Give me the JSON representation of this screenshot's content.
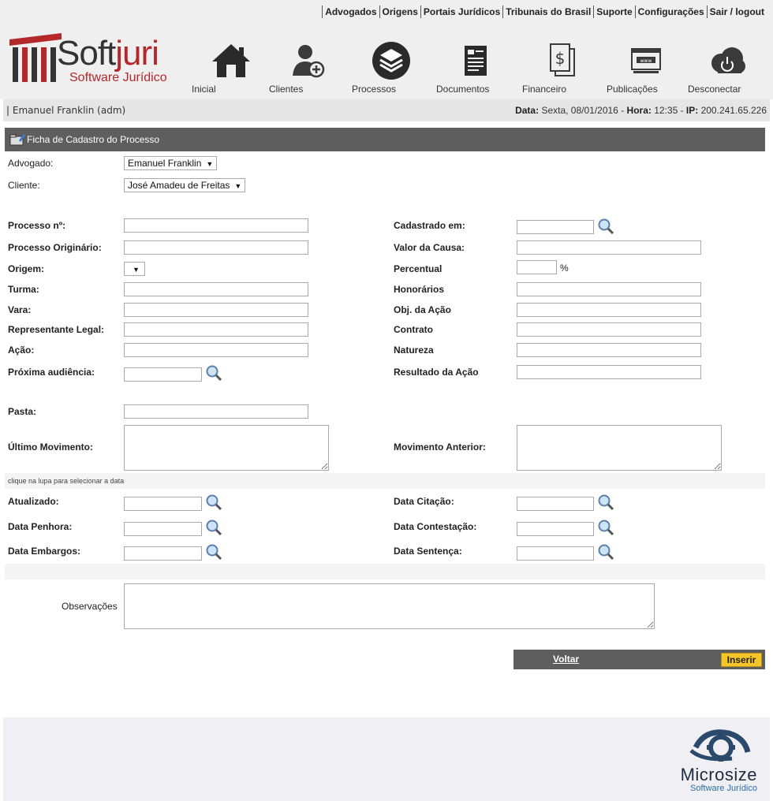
{
  "toplinks": [
    "Advogados",
    "Origens",
    "Portais Jurídicos",
    "Tribunais do Brasil",
    "Suporte",
    "Configurações",
    "Sair / logout"
  ],
  "brand": {
    "name_part1": "Soft",
    "name_part2": "juri",
    "sub": "Software Jurídico"
  },
  "nav": [
    {
      "label": "Inicial",
      "icon": "home-icon"
    },
    {
      "label": "Clientes",
      "icon": "add-client-icon"
    },
    {
      "label": "Processos",
      "icon": "layers-icon"
    },
    {
      "label": "Documentos",
      "icon": "document-icon"
    },
    {
      "label": "Financeiro",
      "icon": "dollar-document-icon"
    },
    {
      "label": "Publicações",
      "icon": "www-publication-icon"
    },
    {
      "label": "Desconectar",
      "icon": "power-cloud-icon"
    }
  ],
  "userbar": {
    "user": "| Emanuel Franklin (adm)",
    "data_label": "Data:",
    "data_value": " Sexta, 08/01/2016 - ",
    "hora_label": "Hora:",
    "hora_value": " 12:35 - ",
    "ip_label": "IP:",
    "ip_value": " 200.241.65.226"
  },
  "panel": {
    "title": "Ficha de Cadastro do Processo"
  },
  "form": {
    "advogado_label": "Advogado:",
    "advogado_value": "Emanuel Franklin",
    "cliente_label": "Cliente:",
    "cliente_value": "José Amadeu de Freitas",
    "processo_label": "Processo nº:",
    "processo_orig_label": "Processo Originário:",
    "origem_label": "Origem:",
    "turma_label": "Turma:",
    "vara_label": "Vara:",
    "representante_label": "Representante Legal:",
    "acao_label": "Ação:",
    "proxima_label": "Próxima audiência:",
    "cadastrado_label": "Cadastrado em:",
    "valor_label": "Valor da Causa:",
    "percentual_label": "Percentual",
    "percent_sign": "%",
    "honorarios_label": "Honorários",
    "obj_label": "Obj. da Ação",
    "contrato_label": "Contrato",
    "natureza_label": "Natureza",
    "resultado_label": "Resultado da Ação",
    "pasta_label": "Pasta:",
    "ultimo_label": "Último Movimento:",
    "anterior_label": "Movimento Anterior:",
    "hint": "clique na lupa para selecionar a data",
    "atualizado_label": "Atualizado:",
    "penhora_label": "Data Penhora:",
    "embargos_label": "Data Embargos:",
    "citacao_label": "Data Citação:",
    "contestacao_label": "Data Contestação:",
    "sentenca_label": "Data Sentença:",
    "observacoes_label": "Observações"
  },
  "buttons": {
    "voltar": "Voltar",
    "inserir": "Inserir"
  },
  "footer": {
    "name": "Microsize",
    "sub": "Software Jurídico"
  },
  "colors": {
    "accent_red": "#b4272b",
    "panel_gray": "#5e5e5e",
    "button_yellow": "#f5c52a"
  }
}
